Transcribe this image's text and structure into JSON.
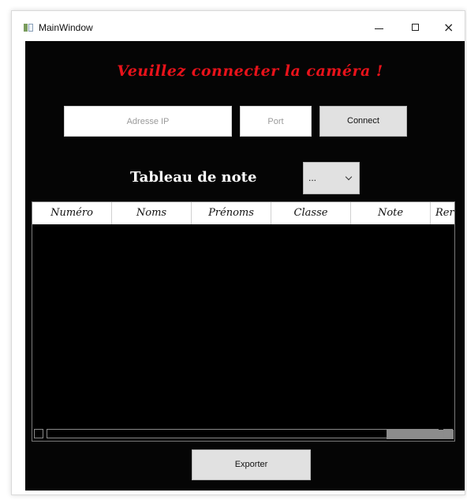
{
  "window": {
    "title": "MainWindow",
    "controls": {
      "minimize": "minimize",
      "maximize": "maximize",
      "close": "×"
    }
  },
  "status": {
    "message": "Veuillez connecter la caméra !",
    "color": "#e8121a"
  },
  "connection": {
    "ip_placeholder": "Adresse IP",
    "port_placeholder": "Port",
    "connect_label": "Connect"
  },
  "grades": {
    "title": "Tableau de note",
    "selector_value": "..."
  },
  "table": {
    "columns": [
      "Numéro",
      "Noms",
      "Prénoms",
      "Classe",
      "Note",
      "Rer"
    ],
    "rows": []
  },
  "actions": {
    "export_label": "Exporter"
  },
  "icons": {
    "app": "app-window-icon",
    "minimize": "minimize-icon",
    "maximize": "maximize-icon",
    "close": "close-icon",
    "dropdown": "chevron-down-icon"
  },
  "colors": {
    "background": "#050505",
    "header_text": "#ffffff",
    "button": "#e1e1e1"
  }
}
